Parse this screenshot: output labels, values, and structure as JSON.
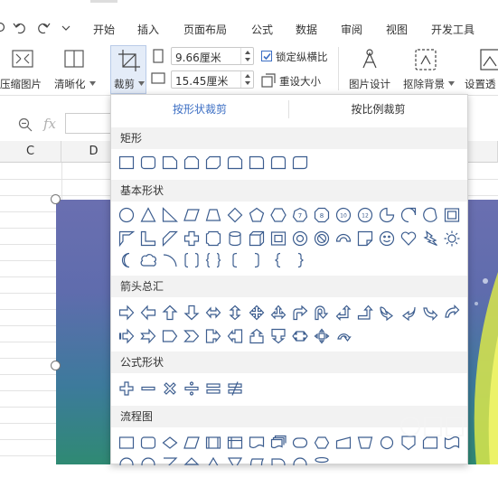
{
  "menu": {
    "tabs": [
      "开始",
      "插入",
      "页面布局",
      "公式",
      "数据",
      "审阅",
      "视图",
      "开发工具"
    ]
  },
  "ribbon": {
    "compress_label": "压缩图片",
    "sharpen_label": "清晰化",
    "crop_label": "裁剪",
    "width_value": "9.66厘米",
    "height_value": "15.45厘米",
    "lock_ratio_label": "锁定纵横比",
    "lock_ratio_checked": true,
    "reset_size_label": "重设大小",
    "picture_design_label": "图片设计",
    "remove_bg_label": "抠除背景",
    "set_transparent_label": "设置透"
  },
  "formula_bar": {
    "fx_label": "fx"
  },
  "sheet": {
    "columns": [
      "C",
      "D"
    ]
  },
  "crop_panel": {
    "tab_shape": "按形状裁剪",
    "tab_ratio": "按比例裁剪",
    "active_tab": "按形状裁剪",
    "sections": [
      "矩形",
      "基本形状",
      "箭头总汇",
      "公式形状",
      "流程图"
    ]
  },
  "colors": {
    "accent": "#3d6fc4",
    "icon_stroke": "#3c5d8f",
    "section_bg": "#f2f2f2"
  }
}
